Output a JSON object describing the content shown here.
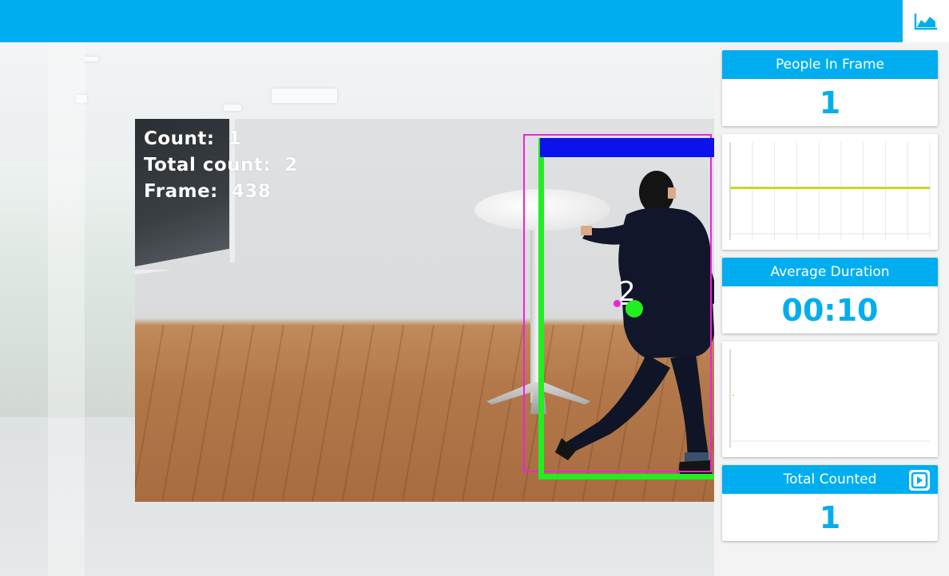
{
  "header": {
    "chart_toggle_icon": "area-chart-icon"
  },
  "video": {
    "overlay": {
      "count_label": "Count:",
      "count_value": "1",
      "total_label": "Total count:",
      "total_value": "2",
      "frame_label": "Frame:",
      "frame_value": "438"
    },
    "track_id": "2",
    "colors": {
      "person_box": "#ee22dd",
      "track_box": "#22ee22",
      "label_bar": "#0b12ee"
    }
  },
  "stats": {
    "people_in_frame": {
      "label": "People In Frame",
      "value": "1"
    },
    "average_duration": {
      "label": "Average Duration",
      "value": "00:10"
    },
    "total_counted": {
      "label": "Total Counted",
      "value": "1",
      "action_icon": "play-icon"
    }
  },
  "chart_data": [
    {
      "type": "line",
      "name": "people-in-frame-sparkline",
      "x": [
        0,
        1,
        2,
        3,
        4,
        5,
        6,
        7,
        8,
        9
      ],
      "series": [
        {
          "values": [
            1,
            1,
            1,
            1,
            1,
            1,
            1,
            1,
            1,
            1
          ],
          "color": "#c5d629"
        }
      ],
      "grid": true
    },
    {
      "type": "line",
      "name": "duration-sparkline",
      "x": [
        0
      ],
      "series": [
        {
          "values": [
            0
          ],
          "color": "#c5d629"
        }
      ],
      "grid": false
    }
  ],
  "theme": {
    "accent": "#00aeef"
  }
}
